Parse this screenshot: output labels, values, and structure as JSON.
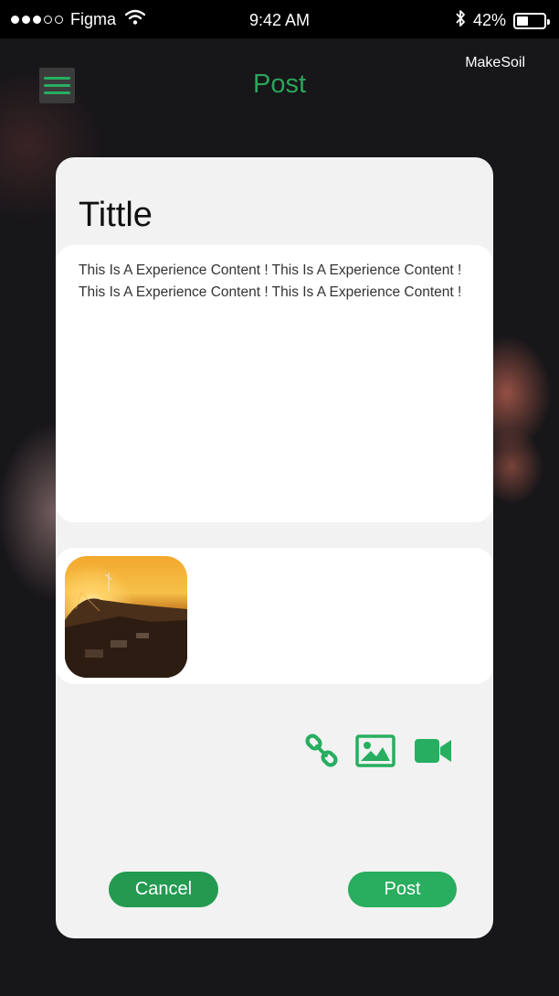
{
  "status_bar": {
    "carrier": "Figma",
    "time": "9:42 AM",
    "battery_percent": "42%",
    "battery_level": 0.42,
    "icons": [
      "signal-dots-icon",
      "wifi-icon",
      "bluetooth-icon",
      "battery-icon"
    ]
  },
  "header": {
    "title": "Post",
    "brand": "MakeSoil",
    "menu_icon": "hamburger-icon"
  },
  "post": {
    "title": "Tittle",
    "content": "This Is A Experience Content ! This Is A Experience Content ! This Is A Experience Content ! This Is A Experience Content !",
    "attachments": [
      {
        "type": "image",
        "description": "sunset-photo"
      }
    ]
  },
  "toolbar": {
    "icons": [
      "link-icon",
      "image-icon",
      "video-icon"
    ]
  },
  "actions": {
    "cancel_label": "Cancel",
    "post_label": "Post"
  },
  "colors": {
    "accent": "#27ae60",
    "title_green": "#2aa55b",
    "card_bg": "#f2f2f2",
    "panel_bg": "#ffffff",
    "background": "#171619"
  }
}
